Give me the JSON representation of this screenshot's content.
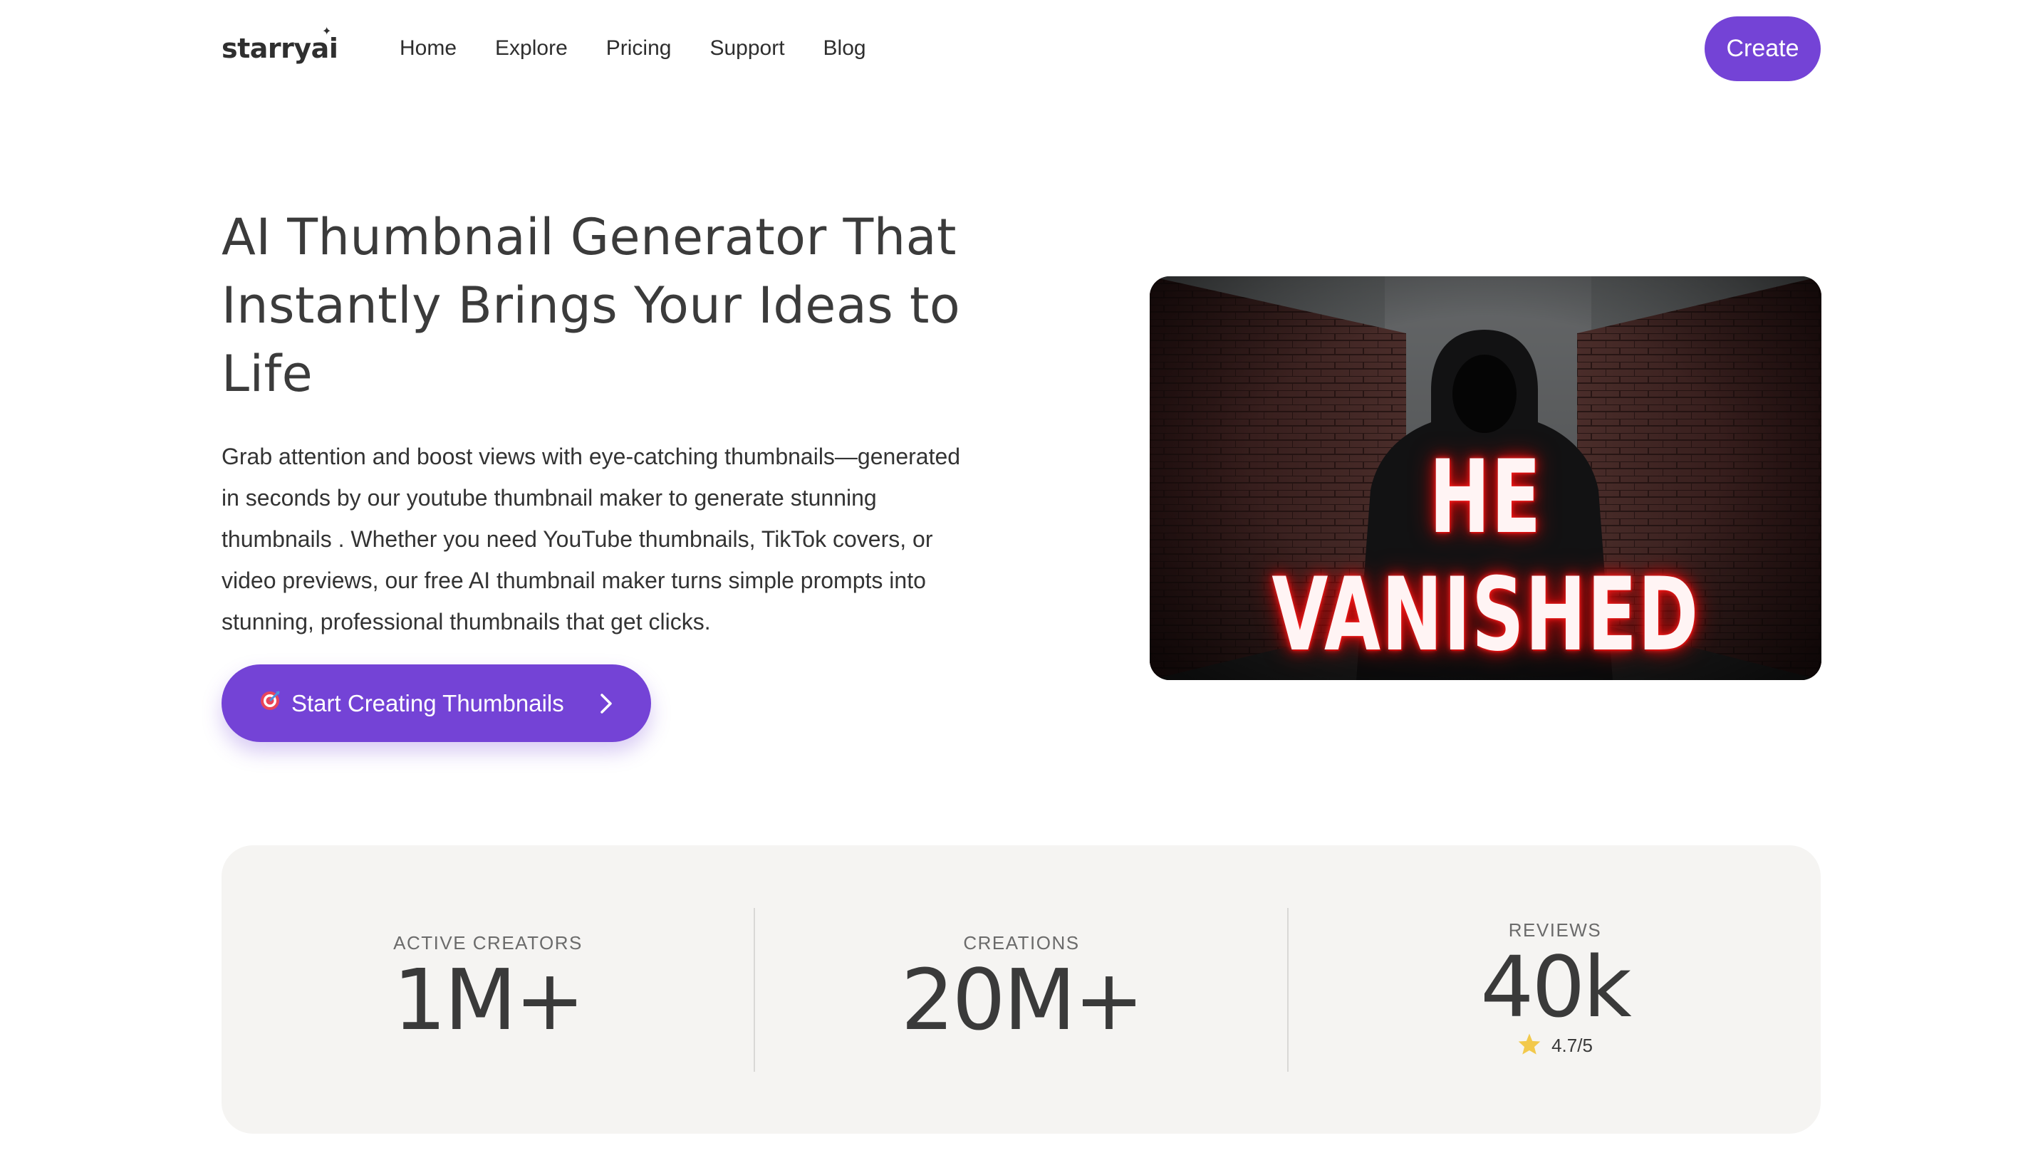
{
  "nav": {
    "logo": "starryai",
    "links": [
      "Home",
      "Explore",
      "Pricing",
      "Support",
      "Blog"
    ],
    "create_label": "Create"
  },
  "hero": {
    "title": "AI Thumbnail Generator That Instantly Brings Your Ideas to Life",
    "description": "Grab attention and boost views with eye-catching thumbnails—generated in seconds by our youtube thumbnail maker to generate stunning thumbnails . Whether you need YouTube thumbnails, TikTok covers, or video previews, our free AI thumbnail maker turns simple prompts into stunning, professional thumbnails that get clicks.",
    "cta_label": "Start Creating Thumbnails",
    "cta_icon": "dart-target-icon"
  },
  "thumbnail": {
    "overlay_text": "HE VANISHED"
  },
  "stats": [
    {
      "label": "ACTIVE CREATORS",
      "value": "1M+"
    },
    {
      "label": "CREATIONS",
      "value": "20M+"
    },
    {
      "label": "REVIEWS",
      "value": "40k",
      "rating": "4.7/5"
    }
  ],
  "colors": {
    "accent": "#7443d6",
    "stats_bg": "#f5f4f2",
    "star": "#f2c94c"
  }
}
